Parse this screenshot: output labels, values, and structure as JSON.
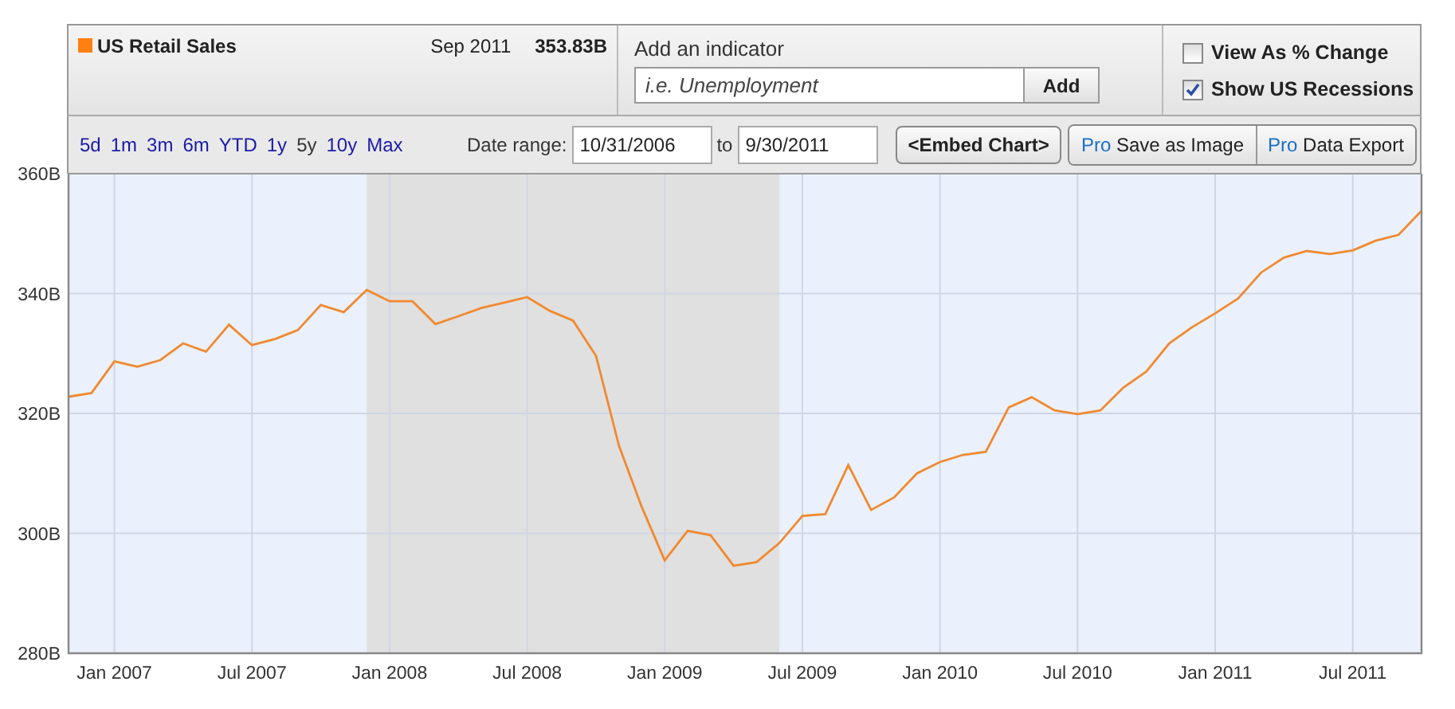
{
  "legend": {
    "color": "#ff7f10",
    "date": "Sep 2011",
    "value": "353.83B"
  },
  "indicator": {
    "label": "Add an indicator",
    "placeholder": "i.e. Unemployment",
    "button": "Add"
  },
  "options": [
    {
      "kind": "percent",
      "label": "View As % Change",
      "checked": false
    },
    {
      "kind": "recessions",
      "label": "Show US Recessions",
      "checked": true
    }
  ],
  "ranges": [
    {
      "label": "5d",
      "selected": false
    },
    {
      "label": "1m",
      "selected": false
    },
    {
      "label": "3m",
      "selected": false
    },
    {
      "label": "6m",
      "selected": false
    },
    {
      "label": "YTD",
      "selected": false
    },
    {
      "label": "1y",
      "selected": false
    },
    {
      "label": "5y",
      "selected": true
    },
    {
      "label": "10y",
      "selected": false
    },
    {
      "label": "Max",
      "selected": false
    }
  ],
  "date_range": {
    "label": "Date range:",
    "from": "10/31/2006",
    "to_label": "to",
    "to": "9/30/2011"
  },
  "buttons": [
    {
      "kind": "embed",
      "label": "<Embed Chart>"
    },
    {
      "kind": "pro",
      "badge": "Pro",
      "label": "Save as Image"
    },
    {
      "kind": "pro",
      "badge": "Pro",
      "label": "Data Export"
    }
  ],
  "chart_data": {
    "type": "line",
    "categories": [
      null,
      null,
      "Jan 2007",
      null,
      null,
      null,
      null,
      null,
      "Jul 2007",
      null,
      null,
      null,
      null,
      null,
      "Jan 2008",
      null,
      null,
      null,
      null,
      null,
      "Jul 2008",
      null,
      null,
      null,
      null,
      null,
      "Jan 2009",
      null,
      null,
      null,
      null,
      null,
      "Jul 2009",
      null,
      null,
      null,
      null,
      null,
      "Jan 2010",
      null,
      null,
      null,
      null,
      null,
      "Jul 2010",
      null,
      null,
      null,
      null,
      null,
      "Jan 2011",
      null,
      null,
      null,
      null,
      null,
      "Jul 2011",
      null,
      null,
      null
    ],
    "series": [
      {
        "name": "US Retail Sales",
        "color": "#f08a30",
        "values": [
          322.8,
          323.4,
          328.7,
          327.8,
          328.9,
          331.7,
          330.3,
          334.8,
          331.4,
          332.4,
          333.9,
          338.1,
          336.9,
          340.6,
          338.7,
          338.7,
          334.9,
          336.2,
          337.6,
          338.5,
          339.4,
          337.1,
          335.5,
          329.6,
          314.6,
          304.4,
          295.5,
          300.4,
          299.7,
          294.6,
          295.2,
          298.4,
          302.9,
          303.2,
          311.4,
          303.9,
          306.0,
          310.0,
          311.9,
          313.1,
          313.6,
          321.0,
          322.7,
          320.5,
          319.9,
          320.5,
          324.3,
          327.0,
          331.7,
          334.4,
          336.7,
          339.2,
          343.5,
          346.0,
          347.1,
          346.6,
          347.2,
          348.8,
          349.8,
          353.8
        ]
      }
    ],
    "ylim": [
      280,
      360
    ],
    "yticks": [
      {
        "value": 280,
        "label": "280B"
      },
      {
        "value": 300,
        "label": "300B"
      },
      {
        "value": 320,
        "label": "320B"
      },
      {
        "value": 340,
        "label": "340B"
      },
      {
        "value": 360,
        "label": "360B"
      }
    ],
    "grid": true
  }
}
